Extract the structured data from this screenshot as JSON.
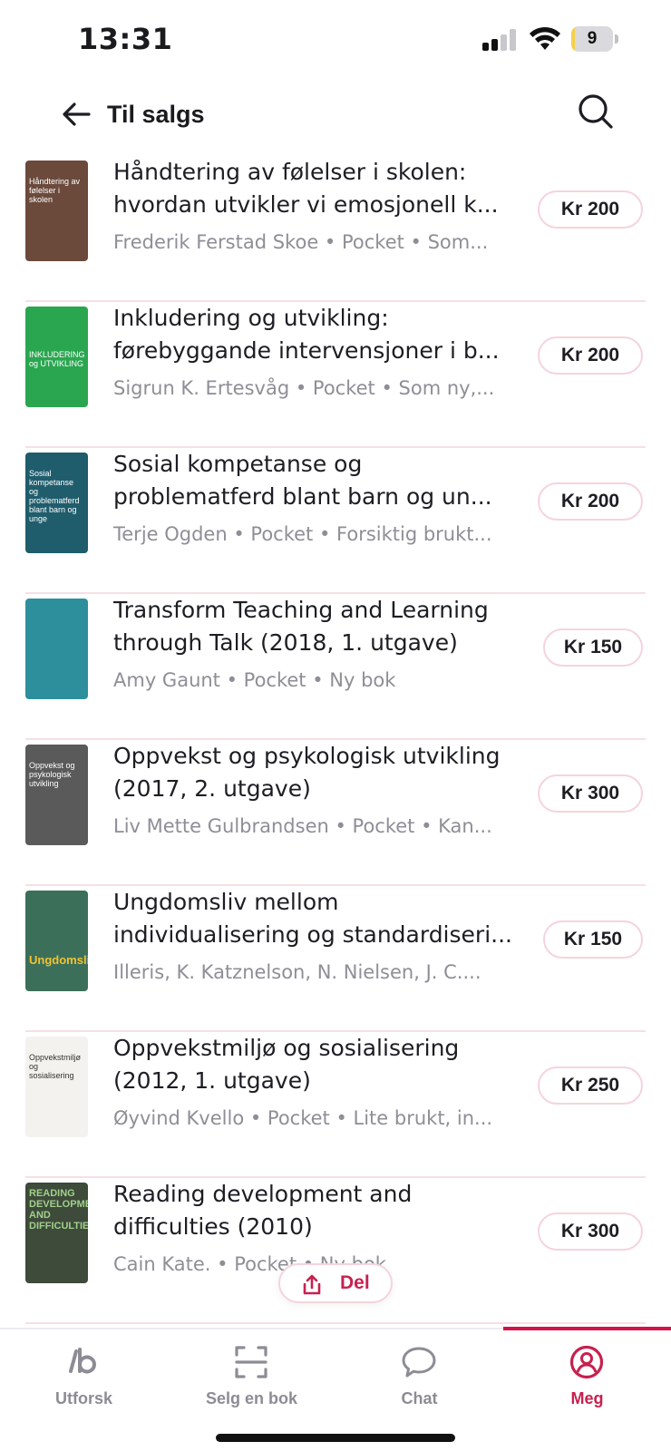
{
  "status_bar": {
    "time": "13:31",
    "battery": "9",
    "battery_level": 0.09
  },
  "header": {
    "title": "Til salgs"
  },
  "books": [
    {
      "title_line1": "Håndtering av følelser i skolen:",
      "title_line2": "hvordan utvikler vi emosjonell k...",
      "meta": "Frederik Ferstad Skoe • Pocket • Som...",
      "price": "Kr 200",
      "cover_color": "#6b4a3c",
      "cover_text": "Håndtering av følelser i skolen"
    },
    {
      "title_line1": "Inkludering og utvikling:",
      "title_line2": "førebyggande intervensjoner i b...",
      "meta": "Sigrun K. Ertesvåg • Pocket • Som ny,...",
      "price": "Kr 200",
      "cover_color": "#2aa650",
      "cover_text": "INKLUDERING og UTVIKLING"
    },
    {
      "title_line1": "Sosial kompetanse og",
      "title_line2": "problematferd blant barn og un...",
      "meta": "Terje Ogden • Pocket • Forsiktig brukt...",
      "price": "Kr 200",
      "cover_color": "#1f5d6c",
      "cover_text": "Sosial kompetanse og problematferd blant barn og unge"
    },
    {
      "title_line1": "Transform Teaching and Learning",
      "title_line2": "through Talk (2018, 1. utgave)",
      "meta": "Amy Gaunt • Pocket • Ny bok",
      "price": "Kr 150",
      "cover_color": "#2d8f9c",
      "cover_text": ""
    },
    {
      "title_line1": "Oppvekst og psykologisk utvikling",
      "title_line2": "(2017, 2. utgave)",
      "meta": "Liv Mette Gulbrandsen • Pocket • Kan...",
      "price": "Kr 300",
      "cover_color": "#5a5a5a",
      "cover_text": "Oppvekst og psykologisk utvikling"
    },
    {
      "title_line1": "Ungdomsliv mellom",
      "title_line2": "individualisering og standardiseri...",
      "meta": "Illeris, K. Katznelson, N. Nielsen, J. C....",
      "price": "Kr 150",
      "cover_color": "#3b6f5a",
      "cover_text": "Ungdomsliv"
    },
    {
      "title_line1": "Oppvekstmiljø og sosialisering",
      "title_line2": "(2012, 1. utgave)",
      "meta": "Øyvind Kvello • Pocket • Lite brukt, in...",
      "price": "Kr 250",
      "cover_color": "#f4f2ee",
      "cover_text": "Oppvekstmiljø og sosialisering"
    },
    {
      "title_line1": "Reading development and",
      "title_line2": "difficulties (2010)",
      "meta": "Cain  Kate. • Pocket • Ny bok",
      "price": "Kr 300",
      "cover_color": "#3e4a3a",
      "cover_text": "READING DEVELOPMENT AND DIFFICULTIES"
    }
  ],
  "share": {
    "label": "Del"
  },
  "tabs": [
    {
      "label": "Utforsk",
      "icon": "books-icon"
    },
    {
      "label": "Selg en bok",
      "icon": "scan-icon"
    },
    {
      "label": "Chat",
      "icon": "chat-bubble-icon"
    },
    {
      "label": "Meg",
      "icon": "profile-icon",
      "active": true
    }
  ],
  "colors": {
    "accent": "#c8204f",
    "pill_border": "#f5d4dc",
    "divider": "#f6dfe5",
    "muted_text": "#8e8e96"
  }
}
